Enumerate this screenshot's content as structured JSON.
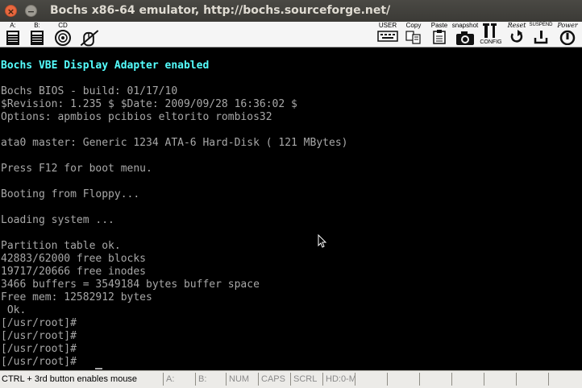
{
  "window": {
    "title": "Bochs x86-64 emulator, http://bochs.sourceforge.net/",
    "close_glyph": "×",
    "minimize_glyph": "−"
  },
  "toolbar": {
    "floppy_a_label": "A:",
    "floppy_b_label": "B:",
    "cdrom_label": "CD",
    "user_label": "USER",
    "copy_label": "Copy",
    "paste_label": "Paste",
    "snapshot_label": "snapshot",
    "config_label": "CONFIG",
    "reset_label": "Reset",
    "suspend_label": "SUSPEND",
    "power_label": "Power"
  },
  "screen": {
    "lines": [
      "Bochs VBE Display Adapter enabled",
      "",
      "Bochs BIOS - build: 01/17/10",
      "$Revision: 1.235 $ $Date: 2009/09/28 16:36:02 $",
      "Options: apmbios pcibios eltorito rombios32",
      "",
      "ata0 master: Generic 1234 ATA-6 Hard-Disk ( 121 MBytes)",
      "",
      "Press F12 for boot menu.",
      "",
      "Booting from Floppy...",
      "",
      "Loading system ...",
      "",
      "Partition table ok.",
      "42883/62000 free blocks",
      "19717/20666 free inodes",
      "3466 buffers = 3549184 bytes buffer space",
      "Free mem: 12582912 bytes",
      " Ok.",
      "[/usr/root]#",
      "[/usr/root]#",
      "[/usr/root]#",
      "[/usr/root]#"
    ]
  },
  "statusbar": {
    "mouse_hint": "CTRL + 3rd button enables mouse",
    "a": "A:",
    "b": "B:",
    "num": "NUM",
    "caps": "CAPS",
    "scrl": "SCRL",
    "hd": "HD:0-M"
  }
}
